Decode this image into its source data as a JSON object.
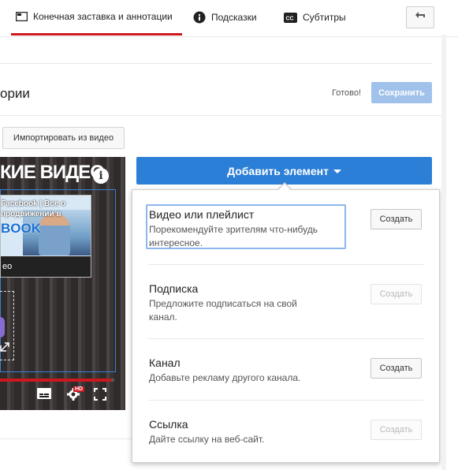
{
  "tabs": [
    {
      "label": "Конечная заставка и аннотации",
      "icon": "end-screen-icon",
      "active": true
    },
    {
      "label": "Подсказки",
      "icon": "info-circle-icon",
      "active": false
    },
    {
      "label": "Субтитры",
      "icon": "cc-icon",
      "active": false
    }
  ],
  "header": {
    "title": "ории",
    "status": "Готово!",
    "save_label": "Сохранить"
  },
  "import_label": "Импортировать из видео",
  "video": {
    "title": "КИЕ ВИДЕО",
    "thumb_text": "Facebook | Все о продвижении в",
    "thumb_big": "BOOK",
    "thumb_caption": "ео",
    "progress": 0.97,
    "hd_badge": "HD"
  },
  "add_element": {
    "label": "Добавить элемент",
    "items": [
      {
        "title": "Видео или плейлист",
        "desc": "Порекомендуйте зрителям что-нибудь интересное.",
        "button": "Создать",
        "enabled": true
      },
      {
        "title": "Подписка",
        "desc": "Предложите подписаться на свой канал.",
        "button": "Создать",
        "enabled": false
      },
      {
        "title": "Канал",
        "desc": "Добавьте рекламу другого канала.",
        "button": "Создать",
        "enabled": true
      },
      {
        "title": "Ссылка",
        "desc": "Дайте ссылку на веб-сайт.",
        "button": "Создать",
        "enabled": false
      }
    ]
  },
  "colors": {
    "accent_red": "#cc181e",
    "primary_blue": "#2c7fd6",
    "save_disabled": "#a0c2ea"
  }
}
